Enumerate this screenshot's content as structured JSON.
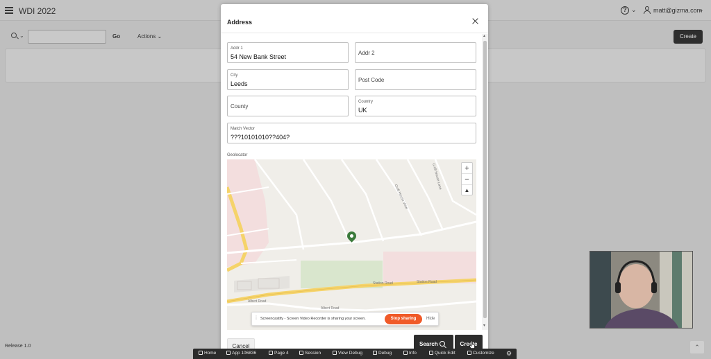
{
  "app": {
    "title": "WDI 2022",
    "user": "matt@gizma.com",
    "release": "Release 1.0"
  },
  "toolbar": {
    "go_label": "Go",
    "actions_label": "Actions",
    "create_label": "Create",
    "search_value": ""
  },
  "dialog": {
    "title": "Address",
    "fields": {
      "addr1": {
        "label": "Addr 1",
        "value": "54 New Bank Street"
      },
      "addr2": {
        "label": "Addr 2",
        "value": ""
      },
      "city": {
        "label": "City",
        "value": "Leeds"
      },
      "postcode": {
        "label": "Post Code",
        "value": ""
      },
      "county": {
        "label": "County",
        "value": ""
      },
      "country": {
        "label": "Country",
        "value": "UK"
      },
      "match_vector": {
        "label": "Match Vector",
        "value": "???10101010??404?"
      }
    },
    "geolocator_label": "Geolocator",
    "map": {
      "roads": [
        "Station Road",
        "Station Road",
        "Albert Road",
        "Albert Road",
        "Croft House View",
        "Croft House Lane"
      ],
      "zoom_in": "+",
      "zoom_out": "−",
      "compass": "▲"
    },
    "cancel_label": "Cancel",
    "search_label": "Search",
    "create_label": "Create"
  },
  "screencastify": {
    "message": "Screencastify - Screen Video Recorder is sharing your screen.",
    "stop_label": "Stop sharing",
    "hide_label": "Hide"
  },
  "dev_toolbar": {
    "items": [
      "Home",
      "App 106836",
      "Page 4",
      "Session",
      "View Debug",
      "Debug",
      "Info",
      "Quick Edit",
      "Customize"
    ]
  },
  "colors": {
    "dark_button": "#2d2d2d",
    "stop_sharing": "#f05a28",
    "map_pin": "#3b7a3b",
    "road_major": "#f5d36a"
  }
}
